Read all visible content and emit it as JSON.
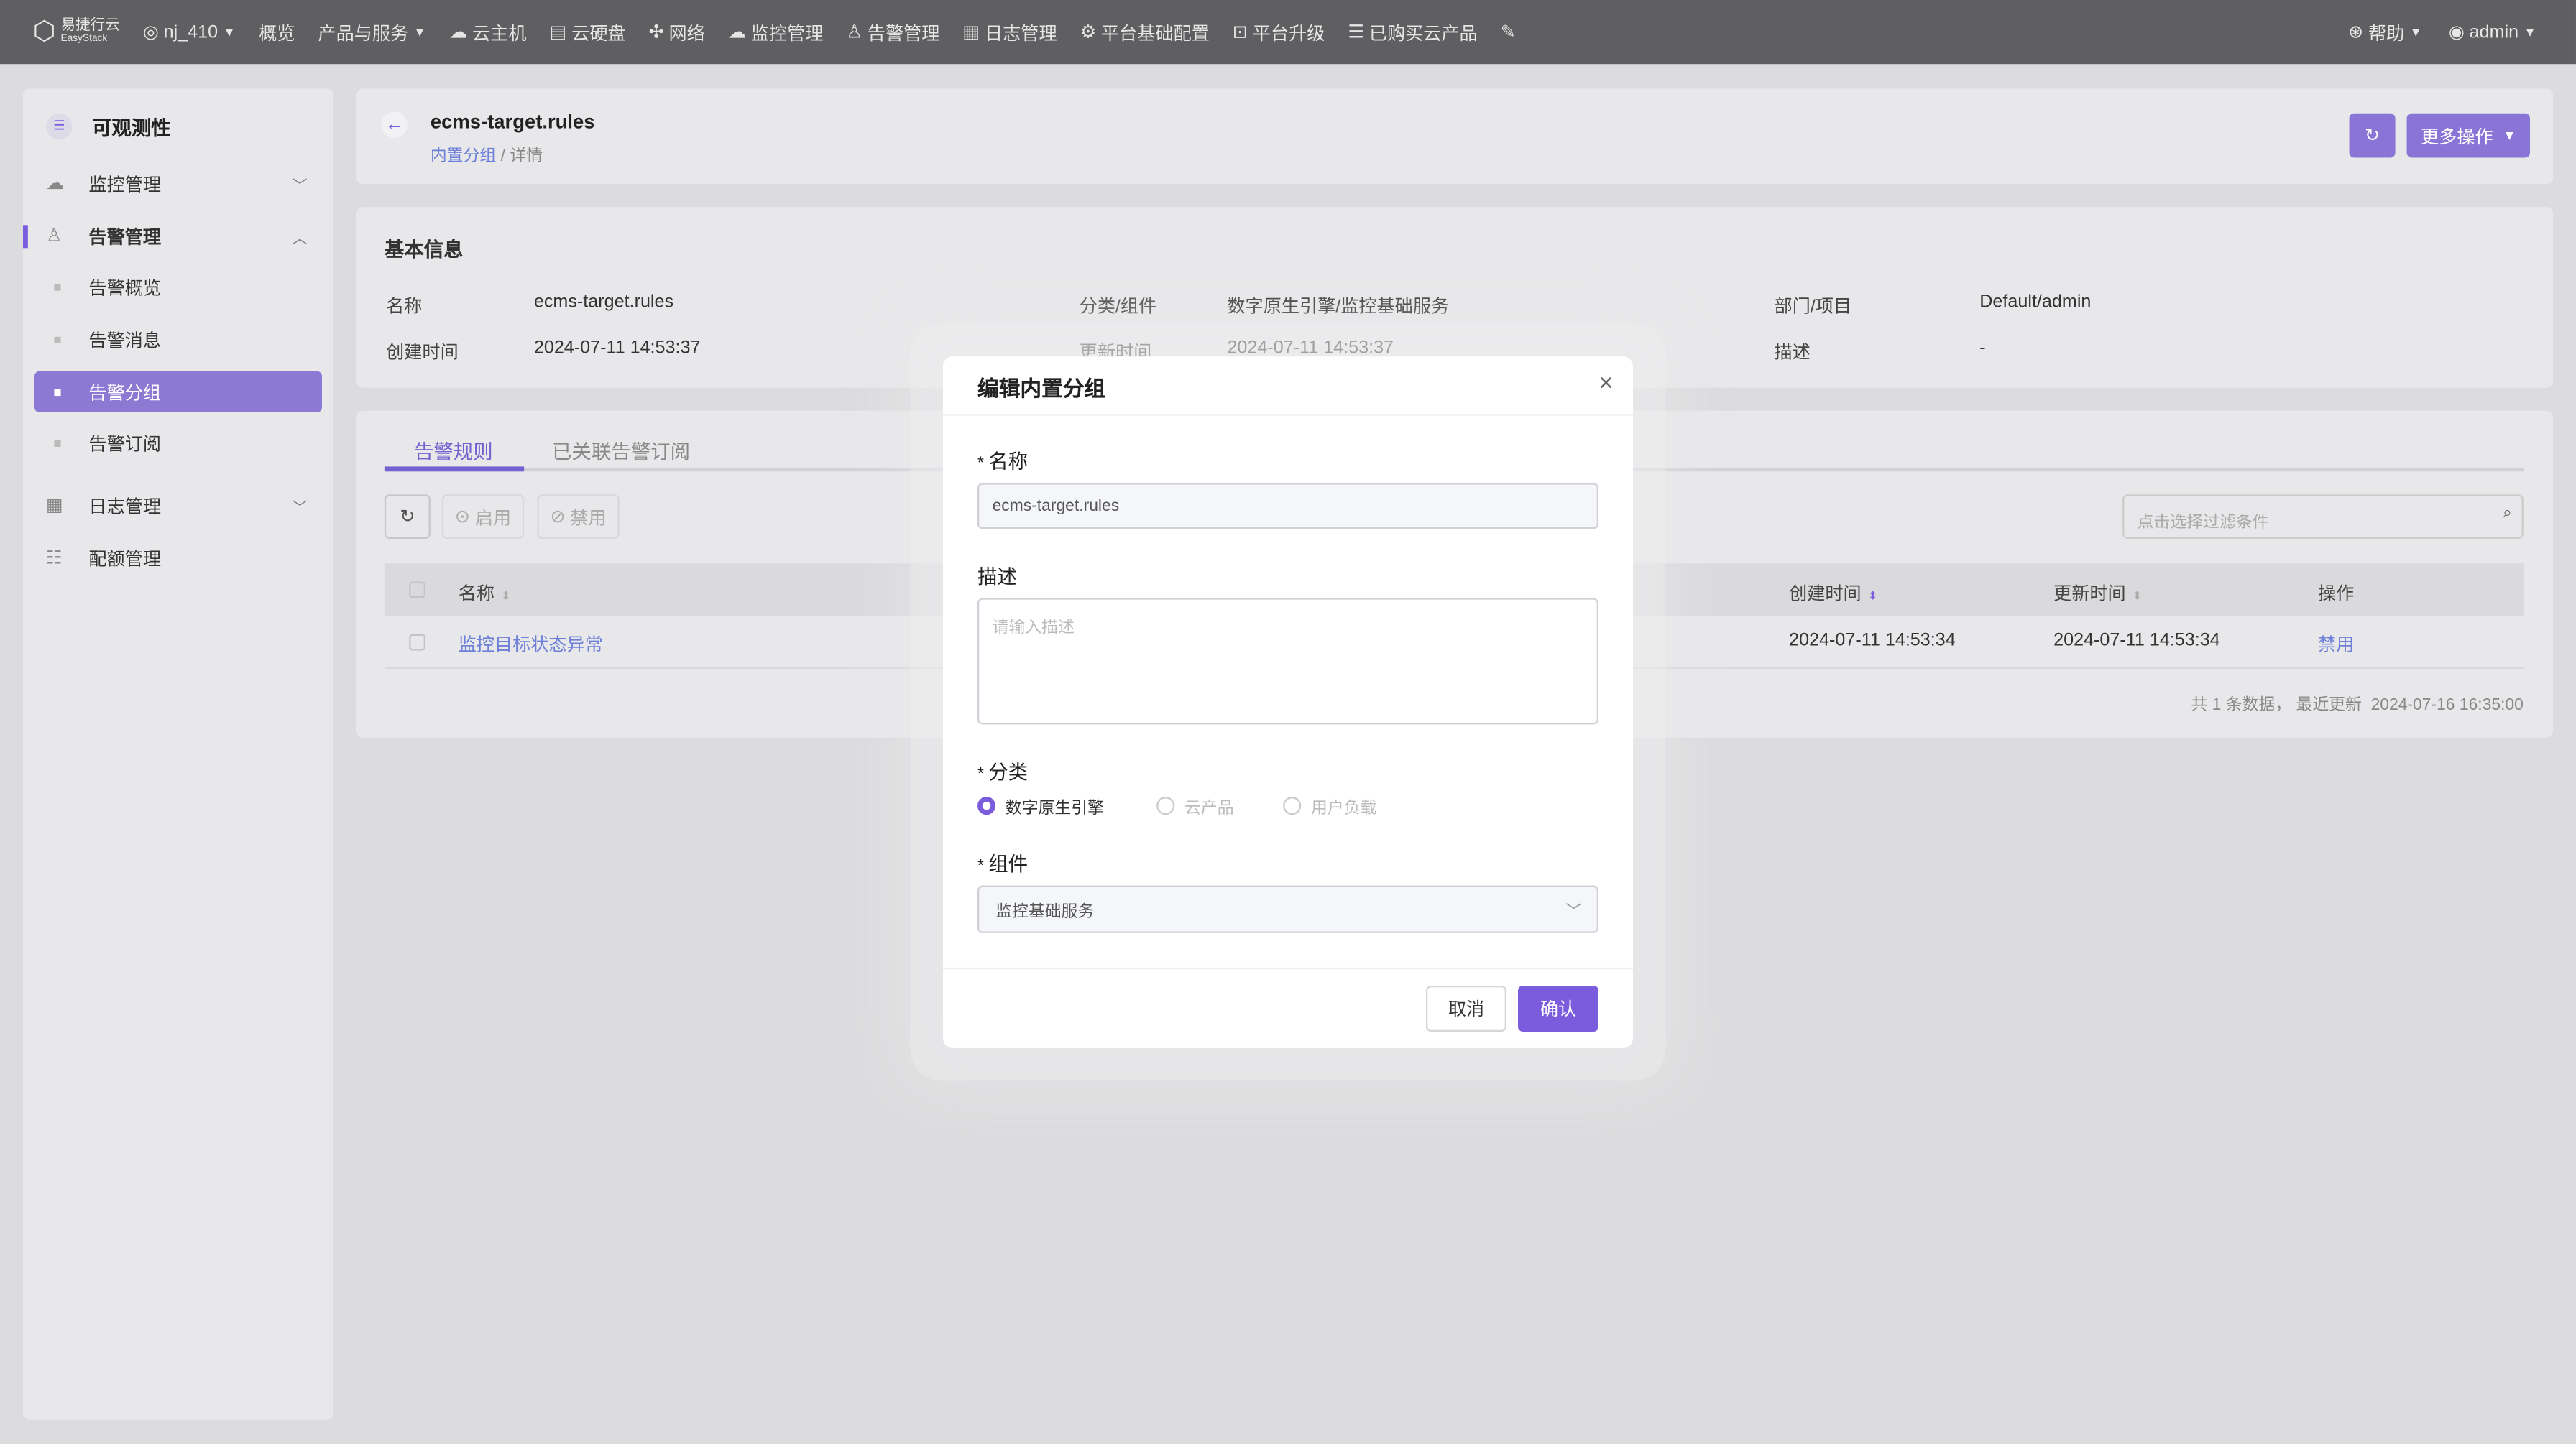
{
  "topbar": {
    "logo_cn": "易捷行云",
    "logo_en": "EasyStack",
    "region": "nj_410",
    "items": [
      "概览",
      "产品与服务",
      "云主机",
      "云硬盘",
      "网络",
      "监控管理",
      "告警管理",
      "日志管理",
      "平台基础配置",
      "平台升级",
      "已购买云产品"
    ],
    "help": "帮助",
    "user": "admin"
  },
  "sidebar": {
    "title": "可观测性",
    "items": [
      {
        "label": "监控管理"
      },
      {
        "label": "告警管理"
      },
      {
        "label": "告警概览"
      },
      {
        "label": "告警消息"
      },
      {
        "label": "告警分组"
      },
      {
        "label": "告警订阅"
      },
      {
        "label": "日志管理"
      },
      {
        "label": "配额管理"
      }
    ]
  },
  "header": {
    "title": "ecms-target.rules",
    "breadcrumb_link": "内置分组",
    "breadcrumb_sep": " / ",
    "breadcrumb_current": "详情",
    "more": "更多操作"
  },
  "basic": {
    "title": "基本信息",
    "name_label": "名称",
    "name": "ecms-target.rules",
    "cat_label": "分类/组件",
    "cat": "数字原生引擎/监控基础服务",
    "dept_label": "部门/项目",
    "dept": "Default/admin",
    "created_label": "创建时间",
    "created": "2024-07-11 14:53:37",
    "updated_label": "更新时间",
    "updated": "2024-07-11 14:53:37",
    "desc_label": "描述",
    "desc": "-"
  },
  "tabs": [
    "告警规则",
    "已关联告警订阅"
  ],
  "toolbar": {
    "enable": "启用",
    "disable": "禁用",
    "filter_placeholder": "点击选择过滤条件"
  },
  "table": {
    "headers": [
      "名称",
      "创建时间",
      "更新时间",
      "操作"
    ],
    "rows": [
      {
        "name": "监控目标状态异常",
        "created": "2024-07-11 14:53:34",
        "updated": "2024-07-11 14:53:34",
        "action": "禁用"
      }
    ],
    "footer": "共 1 条数据， 最近更新  2024-07-16 16:35:00"
  },
  "modal": {
    "title": "编辑内置分组",
    "name_label": "名称",
    "name_value": "ecms-target.rules",
    "desc_label": "描述",
    "desc_placeholder": "请输入描述",
    "cat_label": "分类",
    "cat_options": [
      "数字原生引擎",
      "云产品",
      "用户负载"
    ],
    "comp_label": "组件",
    "comp_value": "监控基础服务",
    "cancel": "取消",
    "confirm": "确认"
  },
  "colors": {
    "accent": "#7b5cdc",
    "topbar": "#5f5f61"
  }
}
